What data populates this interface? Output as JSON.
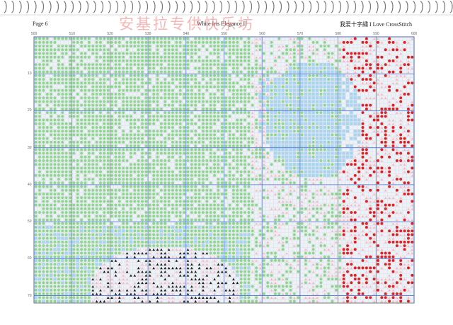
{
  "header": {
    "page_label": "Page 6",
    "title": "White Iris Elegance II",
    "brand": "我爱十字繡 I Love CrossStitch"
  },
  "watermark": {
    "text": "安基拉专供快乐坊"
  },
  "grid": {
    "column_ticks": [
      "500",
      "510",
      "520",
      "530",
      "540",
      "550",
      "560",
      "570",
      "580",
      "590",
      "600"
    ],
    "row_ticks": [
      "10",
      "20",
      "30",
      "40",
      "50",
      "60",
      "70"
    ],
    "colors": {
      "green": "#8ed68e",
      "light_blue": "#a9d4ef",
      "red": "#e02020",
      "dark": "#202020",
      "pink": "#f4b9c2",
      "gridline": "#4a6fd0",
      "background": "#eef1f6"
    }
  }
}
